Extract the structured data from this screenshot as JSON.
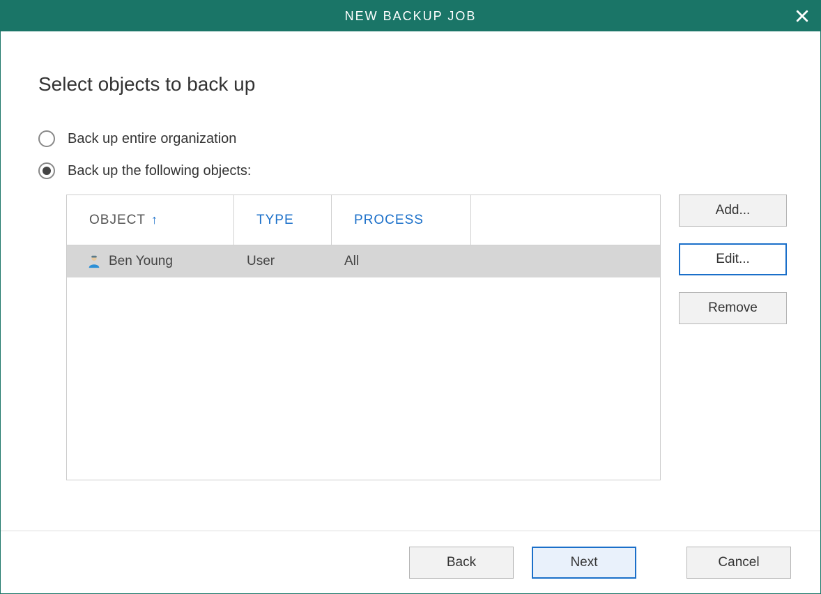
{
  "window": {
    "title": "NEW BACKUP JOB"
  },
  "heading": "Select objects to back up",
  "options": {
    "entire": "Back up entire organization",
    "following": "Back up the following objects:"
  },
  "selected_option": "following",
  "table": {
    "columns": {
      "object": "OBJECT",
      "type": "TYPE",
      "process": "PROCESS"
    },
    "sort": {
      "column": "object",
      "direction": "asc"
    },
    "rows": [
      {
        "object": "Ben Young",
        "type": "User",
        "process": "All",
        "selected": true
      }
    ]
  },
  "side_buttons": {
    "add": "Add...",
    "edit": "Edit...",
    "remove": "Remove"
  },
  "footer": {
    "back": "Back",
    "next": "Next",
    "cancel": "Cancel"
  }
}
